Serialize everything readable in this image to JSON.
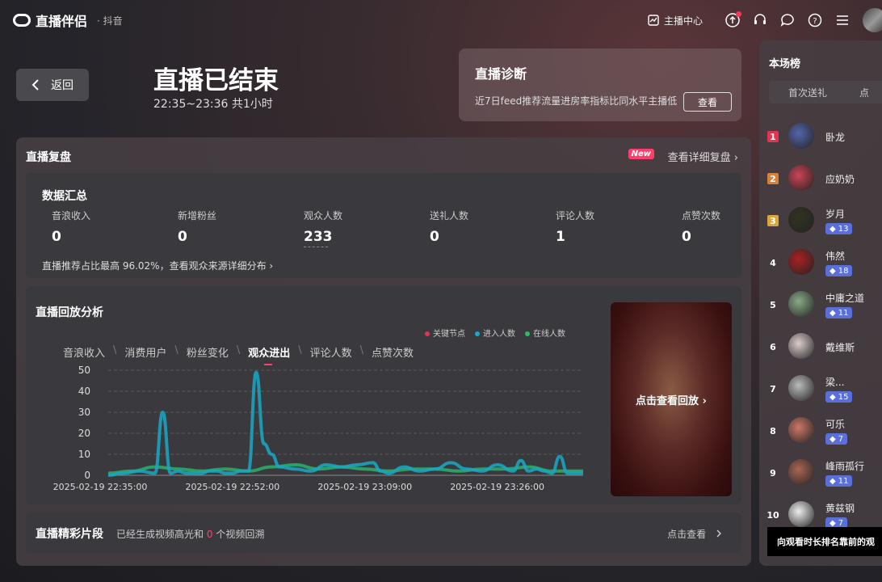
{
  "app": {
    "name": "直播伴侣",
    "sub": "· 抖音"
  },
  "topbar": {
    "anchor_center": "主播中心"
  },
  "back": {
    "label": "返回"
  },
  "ended": {
    "title": "直播已结束",
    "time": "22:35~23:36 共1小时"
  },
  "diagnosis": {
    "title": "直播诊断",
    "desc": "近7日feed推荐流量进房率指标比同水平主播低",
    "button": "查看"
  },
  "replay": {
    "title": "直播复盘",
    "new_badge": "New",
    "detail_link": "查看详细复盘 ›"
  },
  "summary": {
    "title": "数据汇总",
    "stats": [
      {
        "label": "音浪收入",
        "value": "0"
      },
      {
        "label": "新增粉丝",
        "value": "0"
      },
      {
        "label": "观众人数",
        "value": "233"
      },
      {
        "label": "送礼人数",
        "value": "0"
      },
      {
        "label": "评论人数",
        "value": "1"
      },
      {
        "label": "点赞次数",
        "value": "0"
      }
    ],
    "footer": "直播推荐占比最高 96.02%，查看观众来源详细分布 ›"
  },
  "analysis": {
    "title": "直播回放分析",
    "tabs": [
      "音浪收入",
      "消费用户",
      "粉丝变化",
      "观众进出",
      "评论人数",
      "点赞次数"
    ],
    "active_tab": 3,
    "playback_label": "点击查看回放 ›"
  },
  "chart_data": {
    "type": "line",
    "legend": [
      "关键节点",
      "进入人数",
      "在线人数"
    ],
    "colors": {
      "key": "#e0344f",
      "enter": "#1aa8c4",
      "online": "#2bb86f"
    },
    "ylim": [
      0,
      50
    ],
    "yticks": [
      0,
      10,
      20,
      30,
      40,
      50
    ],
    "x_labels": [
      "2025-02-19 22:35:00",
      "2025-02-19 22:52:00",
      "2025-02-19 23:09:00",
      "2025-02-19 23:26:00"
    ],
    "x_range_minutes": [
      0,
      61
    ],
    "series": [
      {
        "name": "进入人数",
        "x": [
          0,
          2,
          4,
          6,
          7,
          8,
          9,
          10,
          11,
          12,
          13,
          14,
          15,
          16,
          17,
          18,
          19,
          20,
          21,
          22,
          24,
          26,
          28,
          30,
          32,
          34,
          35,
          36,
          38,
          40,
          42,
          44,
          46,
          48,
          50,
          52,
          53,
          54,
          55,
          56,
          57,
          58,
          59,
          60,
          61
        ],
        "y": [
          0,
          1,
          2,
          1,
          30,
          1,
          2,
          1,
          1,
          1,
          2,
          2,
          1,
          1,
          2,
          2,
          49,
          15,
          10,
          4,
          3,
          2,
          5,
          4,
          5,
          6,
          2,
          1,
          4,
          2,
          3,
          6,
          3,
          2,
          5,
          2,
          7,
          2,
          3,
          2,
          1,
          9,
          1,
          1,
          1
        ]
      },
      {
        "name": "在线人数",
        "x": [
          0,
          3,
          6,
          9,
          12,
          15,
          18,
          21,
          24,
          27,
          30,
          33,
          36,
          39,
          42,
          45,
          48,
          51,
          54,
          57,
          60,
          61
        ],
        "y": [
          1,
          2,
          4,
          3,
          2,
          3,
          2,
          4,
          5,
          3,
          4,
          3,
          2,
          3,
          3,
          2,
          3,
          3,
          4,
          2,
          2,
          2
        ]
      }
    ]
  },
  "highlights": {
    "title": "直播精彩片段",
    "desc_prefix": "已经生成视频高光和",
    "desc_count": "0",
    "desc_suffix": "个视频回溯",
    "link": "点击查看"
  },
  "ranking": {
    "title": "本场榜",
    "tab1": "首次送礼",
    "tab2": "点",
    "items": [
      {
        "rank": "1",
        "name": "卧龙",
        "badge": "",
        "color": "#5566aa"
      },
      {
        "rank": "2",
        "name": "应奶奶",
        "badge": "",
        "color": "#cc4455"
      },
      {
        "rank": "3",
        "name": "岁月",
        "badge": "13",
        "color": "#333322"
      },
      {
        "rank": "4",
        "name": "伟然",
        "badge": "18",
        "color": "#aa2222"
      },
      {
        "rank": "5",
        "name": "中庸之道",
        "badge": "11",
        "color": "#88aa88"
      },
      {
        "rank": "6",
        "name": "戴维斯",
        "badge": "",
        "color": "#ddcccc"
      },
      {
        "rank": "7",
        "name": "梁...",
        "badge": "15",
        "color": "#bbbbbb"
      },
      {
        "rank": "8",
        "name": "可乐",
        "badge": "7",
        "color": "#cc7766"
      },
      {
        "rank": "9",
        "name": "峰雨孤行",
        "badge": "11",
        "color": "#aa6655"
      },
      {
        "rank": "10",
        "name": "黄兹钢",
        "badge": "7",
        "color": "#eeeeee"
      }
    ],
    "tooltip": "向观看时长排名靠前的观"
  }
}
